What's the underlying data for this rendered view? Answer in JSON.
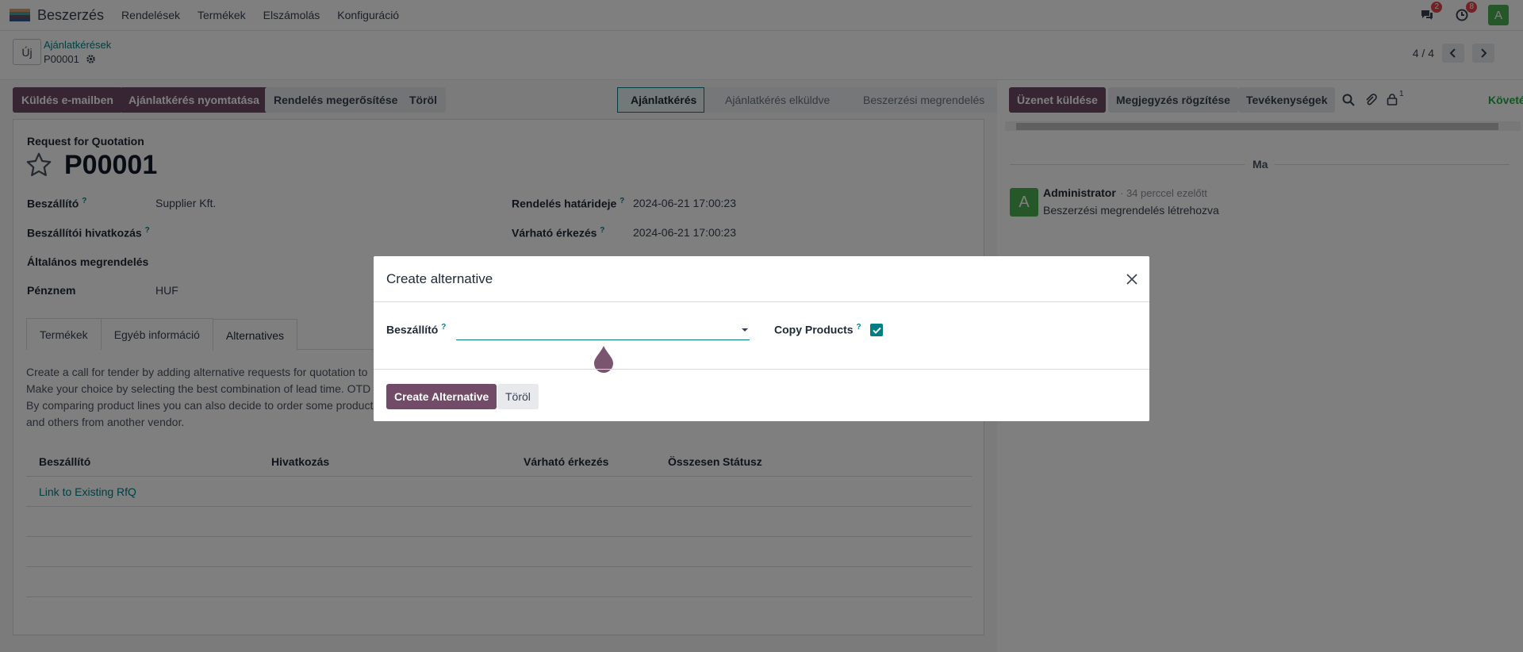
{
  "navbar": {
    "app_name": "Beszerzés",
    "menu": [
      "Rendelések",
      "Termékek",
      "Elszámolás",
      "Konfiguráció"
    ],
    "messages_badge": "2",
    "activities_badge": "8",
    "user_initial": "A"
  },
  "control": {
    "new_label": "Új",
    "breadcrumb_parent": "Ajánlatkérések",
    "breadcrumb_current": "P00001",
    "pager": "4 / 4"
  },
  "actions": {
    "send_email": "Küldés e-mailben",
    "print_rfq": "Ajánlatkérés nyomtatása",
    "confirm_order": "Rendelés megerősítése",
    "cancel": "Töröl"
  },
  "status_stages": [
    "Ajánlatkérés",
    "Ajánlatkérés elküldve",
    "Beszerzési megrendelés"
  ],
  "form": {
    "subtitle": "Request for Quotation",
    "name": "P00001",
    "vendor_label": "Beszállító",
    "vendor_value": "Supplier Kft.",
    "vendor_ref_label": "Beszállítói hivatkozás",
    "blanket_label": "Általános megrendelés",
    "currency_label": "Pénznem",
    "currency_value": "HUF",
    "deadline_label": "Rendelés határideje",
    "deadline_value": "2024-06-21 17:00:23",
    "expected_label": "Várható érkezés",
    "expected_value": "2024-06-21 17:00:23",
    "tabs": [
      "Termékek",
      "Egyéb információ",
      "Alternatives"
    ],
    "help_lines": [
      "Create a call for tender by adding alternative requests for quotation to",
      "Make your choice by selecting the best combination of lead time. OTD",
      "By comparing product lines you can also decide to order some product",
      "and others from another vendor."
    ],
    "table_headers": [
      "Beszállító",
      "Hivatkozás",
      "Várható érkezés",
      "Összesen",
      "Státusz"
    ],
    "link_existing": "Link to Existing RfQ"
  },
  "chatter": {
    "send_message": "Üzenet küldése",
    "log_note": "Megjegyzés rögzítése",
    "activities": "Tevékenységek",
    "followers_count": "1",
    "follow": "Követés",
    "date_separator": "Ma",
    "author": "Administrator",
    "time": "· 34 perccel ezelőtt",
    "body": "Beszerzési megrendelés létrehozva",
    "avatar_initial": "A"
  },
  "dialog": {
    "title": "Create alternative",
    "vendor_label": "Beszállító",
    "vendor_value": "",
    "copy_products_label": "Copy Products",
    "copy_products_checked": true,
    "create_button": "Create Alternative",
    "cancel_button": "Töröl"
  },
  "colors": {
    "primary": "#714b67",
    "accent": "#017e84",
    "follow": "#28a745",
    "badge": "#e5454b"
  }
}
